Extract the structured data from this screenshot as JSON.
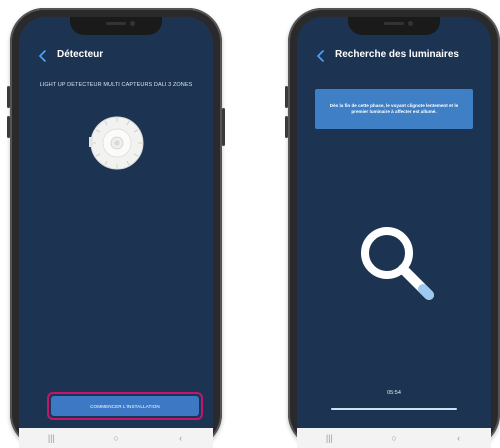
{
  "left_screen": {
    "title": "Détecteur",
    "product_name": "LIGHT UP DETECTEUR MULTI CAPTEURS DALI 3 ZONES",
    "cta_label": "COMMENCER L'INSTALLATION",
    "cta_highlight_color": "#c2156e"
  },
  "right_screen": {
    "title": "Recherche des luminaires",
    "info_text": "Dès la fin de cette phase, le voyant clignote lentement et le premier luminaire à affecter est allumé.",
    "timer": "05:54",
    "progress": 1.0
  },
  "navbar": {
    "recents_glyph": "|||",
    "home_glyph": "○",
    "back_glyph": "‹"
  },
  "colors": {
    "screen_bg": "#1c3452",
    "accent": "#4da3ff",
    "button": "#3d78c4"
  },
  "icons": {
    "back": "chevron-left-icon",
    "search": "magnifier-icon"
  }
}
